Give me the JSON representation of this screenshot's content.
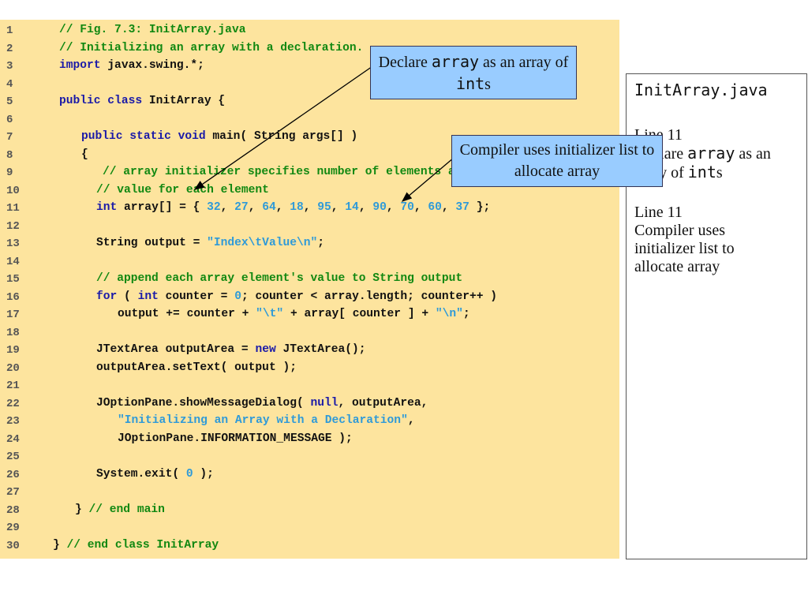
{
  "code": {
    "lines": [
      {
        "n": "1",
        "tokens": [
          [
            "c",
            "// Fig. 7.3: InitArray.java"
          ]
        ]
      },
      {
        "n": "2",
        "tokens": [
          [
            "c",
            "// Initializing an array with a declaration."
          ]
        ]
      },
      {
        "n": "3",
        "tokens": [
          [
            "k",
            "import"
          ],
          [
            "p",
            " javax.swing.*;"
          ]
        ]
      },
      {
        "n": "4",
        "tokens": []
      },
      {
        "n": "5",
        "tokens": [
          [
            "k",
            "public class"
          ],
          [
            "p",
            " InitArray {"
          ]
        ]
      },
      {
        "n": "6",
        "tokens": []
      },
      {
        "n": "7",
        "tokens": [
          [
            "k",
            "public static void"
          ],
          [
            "p",
            " main( String args[] )"
          ]
        ]
      },
      {
        "n": "8",
        "tokens": [
          [
            "p",
            "{"
          ]
        ]
      },
      {
        "n": "9",
        "tokens": [
          [
            "c",
            "// array initializer specifies number of elements and"
          ]
        ]
      },
      {
        "n": "10",
        "tokens": [
          [
            "c",
            "// value for each element"
          ]
        ]
      },
      {
        "n": "11",
        "tokens": [
          [
            "k",
            "int"
          ],
          [
            "p",
            " array[] = { "
          ],
          [
            "s",
            "32"
          ],
          [
            "p",
            ", "
          ],
          [
            "s",
            "27"
          ],
          [
            "p",
            ", "
          ],
          [
            "s",
            "64"
          ],
          [
            "p",
            ", "
          ],
          [
            "s",
            "18"
          ],
          [
            "p",
            ", "
          ],
          [
            "s",
            "95"
          ],
          [
            "p",
            ", "
          ],
          [
            "s",
            "14"
          ],
          [
            "p",
            ", "
          ],
          [
            "s",
            "90"
          ],
          [
            "p",
            ", "
          ],
          [
            "s",
            "70"
          ],
          [
            "p",
            ", "
          ],
          [
            "s",
            "60"
          ],
          [
            "p",
            ", "
          ],
          [
            "s",
            "37"
          ],
          [
            "p",
            " };"
          ]
        ]
      },
      {
        "n": "12",
        "tokens": []
      },
      {
        "n": "13",
        "tokens": [
          [
            "p",
            "String output = "
          ],
          [
            "s",
            "\"Index\\tValue\\n\""
          ],
          [
            "p",
            ";"
          ]
        ]
      },
      {
        "n": "14",
        "tokens": []
      },
      {
        "n": "15",
        "tokens": [
          [
            "c",
            "// append each array element's value to String output"
          ]
        ]
      },
      {
        "n": "16",
        "tokens": [
          [
            "k",
            "for"
          ],
          [
            "p",
            " ( "
          ],
          [
            "k",
            "int"
          ],
          [
            "p",
            " counter = "
          ],
          [
            "s",
            "0"
          ],
          [
            "p",
            "; counter < array.length; counter++ )"
          ]
        ]
      },
      {
        "n": "17",
        "tokens": [
          [
            "p",
            "output += counter + "
          ],
          [
            "s",
            "\"\\t\""
          ],
          [
            "p",
            " + array[ counter ] + "
          ],
          [
            "s",
            "\"\\n\""
          ],
          [
            "p",
            ";"
          ]
        ]
      },
      {
        "n": "18",
        "tokens": []
      },
      {
        "n": "19",
        "tokens": [
          [
            "p",
            "JTextArea outputArea = "
          ],
          [
            "k",
            "new"
          ],
          [
            "p",
            " JTextArea();"
          ]
        ]
      },
      {
        "n": "20",
        "tokens": [
          [
            "p",
            "outputArea.setText( output );"
          ]
        ]
      },
      {
        "n": "21",
        "tokens": []
      },
      {
        "n": "22",
        "tokens": [
          [
            "p",
            "JOptionPane.showMessageDialog( "
          ],
          [
            "k",
            "null"
          ],
          [
            "p",
            ", outputArea,"
          ]
        ]
      },
      {
        "n": "23",
        "tokens": [
          [
            "s",
            "\"Initializing an Array with a Declaration\""
          ],
          [
            "p",
            ","
          ]
        ]
      },
      {
        "n": "24",
        "tokens": [
          [
            "p",
            "JOptionPane.INFORMATION_MESSAGE );"
          ]
        ]
      },
      {
        "n": "25",
        "tokens": []
      },
      {
        "n": "26",
        "tokens": [
          [
            "p",
            "System.exit( "
          ],
          [
            "s",
            "0"
          ],
          [
            "p",
            " );"
          ]
        ]
      },
      {
        "n": "27",
        "tokens": []
      },
      {
        "n": "28",
        "tokens": [
          [
            "p",
            "} "
          ],
          [
            "c",
            "// end main"
          ]
        ]
      },
      {
        "n": "29",
        "tokens": []
      },
      {
        "n": "30",
        "tokens": [
          [
            "p",
            "} "
          ],
          [
            "c",
            "// end class InitArray"
          ]
        ]
      }
    ]
  },
  "callouts": {
    "declare": {
      "pre": "Declare ",
      "code": "array",
      "mid": " as an array of ",
      "code2": "int",
      "post": "s"
    },
    "compiler": {
      "text": "Compiler uses initializer list to allocate array"
    }
  },
  "side": {
    "title": "InitArray.java",
    "note1": {
      "line": "Line 11",
      "pre": "Declare ",
      "code": "array",
      "mid": " as an array of ",
      "code2": "int",
      "post": "s"
    },
    "note2": {
      "line": "Line 11",
      "text": "Compiler uses initializer list to allocate array"
    }
  },
  "colors": {
    "code_bg": "#fde49e",
    "comment": "#118811",
    "keyword": "#1a1aa8",
    "literal": "#2f9ad8",
    "callout_bg": "#99ccff"
  }
}
